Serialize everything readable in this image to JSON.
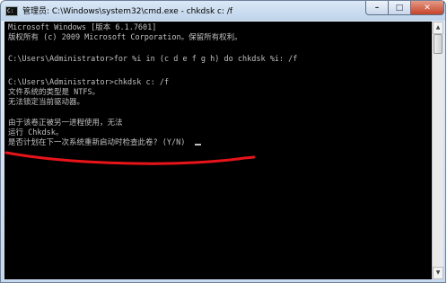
{
  "window": {
    "title": "管理员: C:\\Windows\\system32\\cmd.exe - chkdsk  c: /f",
    "icon": "cmd-icon",
    "controls": {
      "minimize": "–",
      "maximize": "□",
      "close": "✕"
    }
  },
  "console": {
    "lines": [
      "Microsoft Windows [版本 6.1.7601]",
      "版权所有 (c) 2009 Microsoft Corporation。保留所有权利。",
      "",
      "C:\\Users\\Administrator>for %i in (c d e f g h) do chkdsk %i: /f",
      "",
      "C:\\Users\\Administrator>chkdsk c: /f",
      "文件系统的类型是 NTFS。",
      "无法锁定当前驱动器。",
      "",
      "由于该卷正被另一进程使用，无法",
      "运行 Chkdsk。",
      "是否计划在下一次系统重新启动时检查此卷? (Y/N) "
    ]
  },
  "annotation": {
    "color": "#e8141a"
  }
}
